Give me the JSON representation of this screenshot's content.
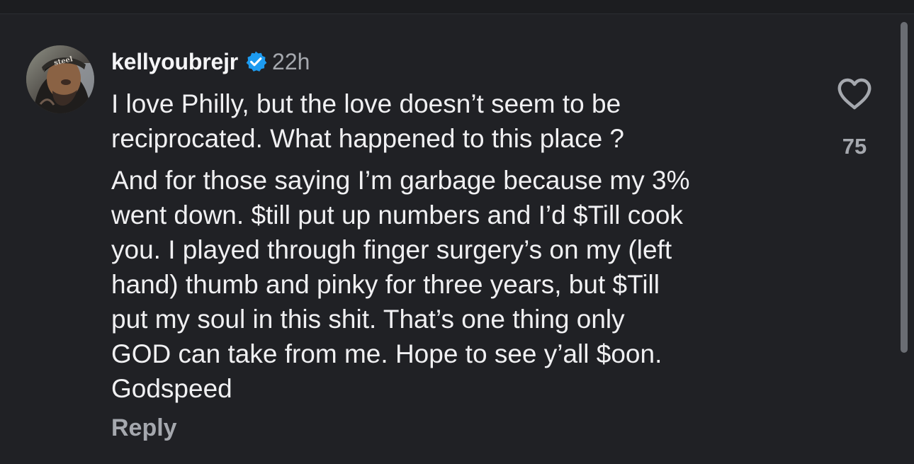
{
  "comment": {
    "username": "kellyoubrejr",
    "timestamp": "22h",
    "verified_icon": "verified-badge-icon",
    "paragraphs": [
      "I love Philly, but the love doesn’t seem to be\nreciprocated. What happened to this place ?",
      "And for those saying I’m garbage because my 3%\nwent down. $till put up numbers and I’d $Till cook\nyou. I played through finger surgery’s on my (left\nhand) thumb and pinky for three years, but $Till\nput my soul in this shit. That’s one thing only\nGOD can take from me. Hope to see y’all $oon.\nGodspeed"
    ],
    "reply_label": "Reply",
    "like_icon": "heart-outline-icon",
    "like_count": "75",
    "colors": {
      "background": "#202125",
      "text": "#f0f0f2",
      "muted": "#a5a8ae",
      "verified": "#1d9bf0"
    }
  }
}
